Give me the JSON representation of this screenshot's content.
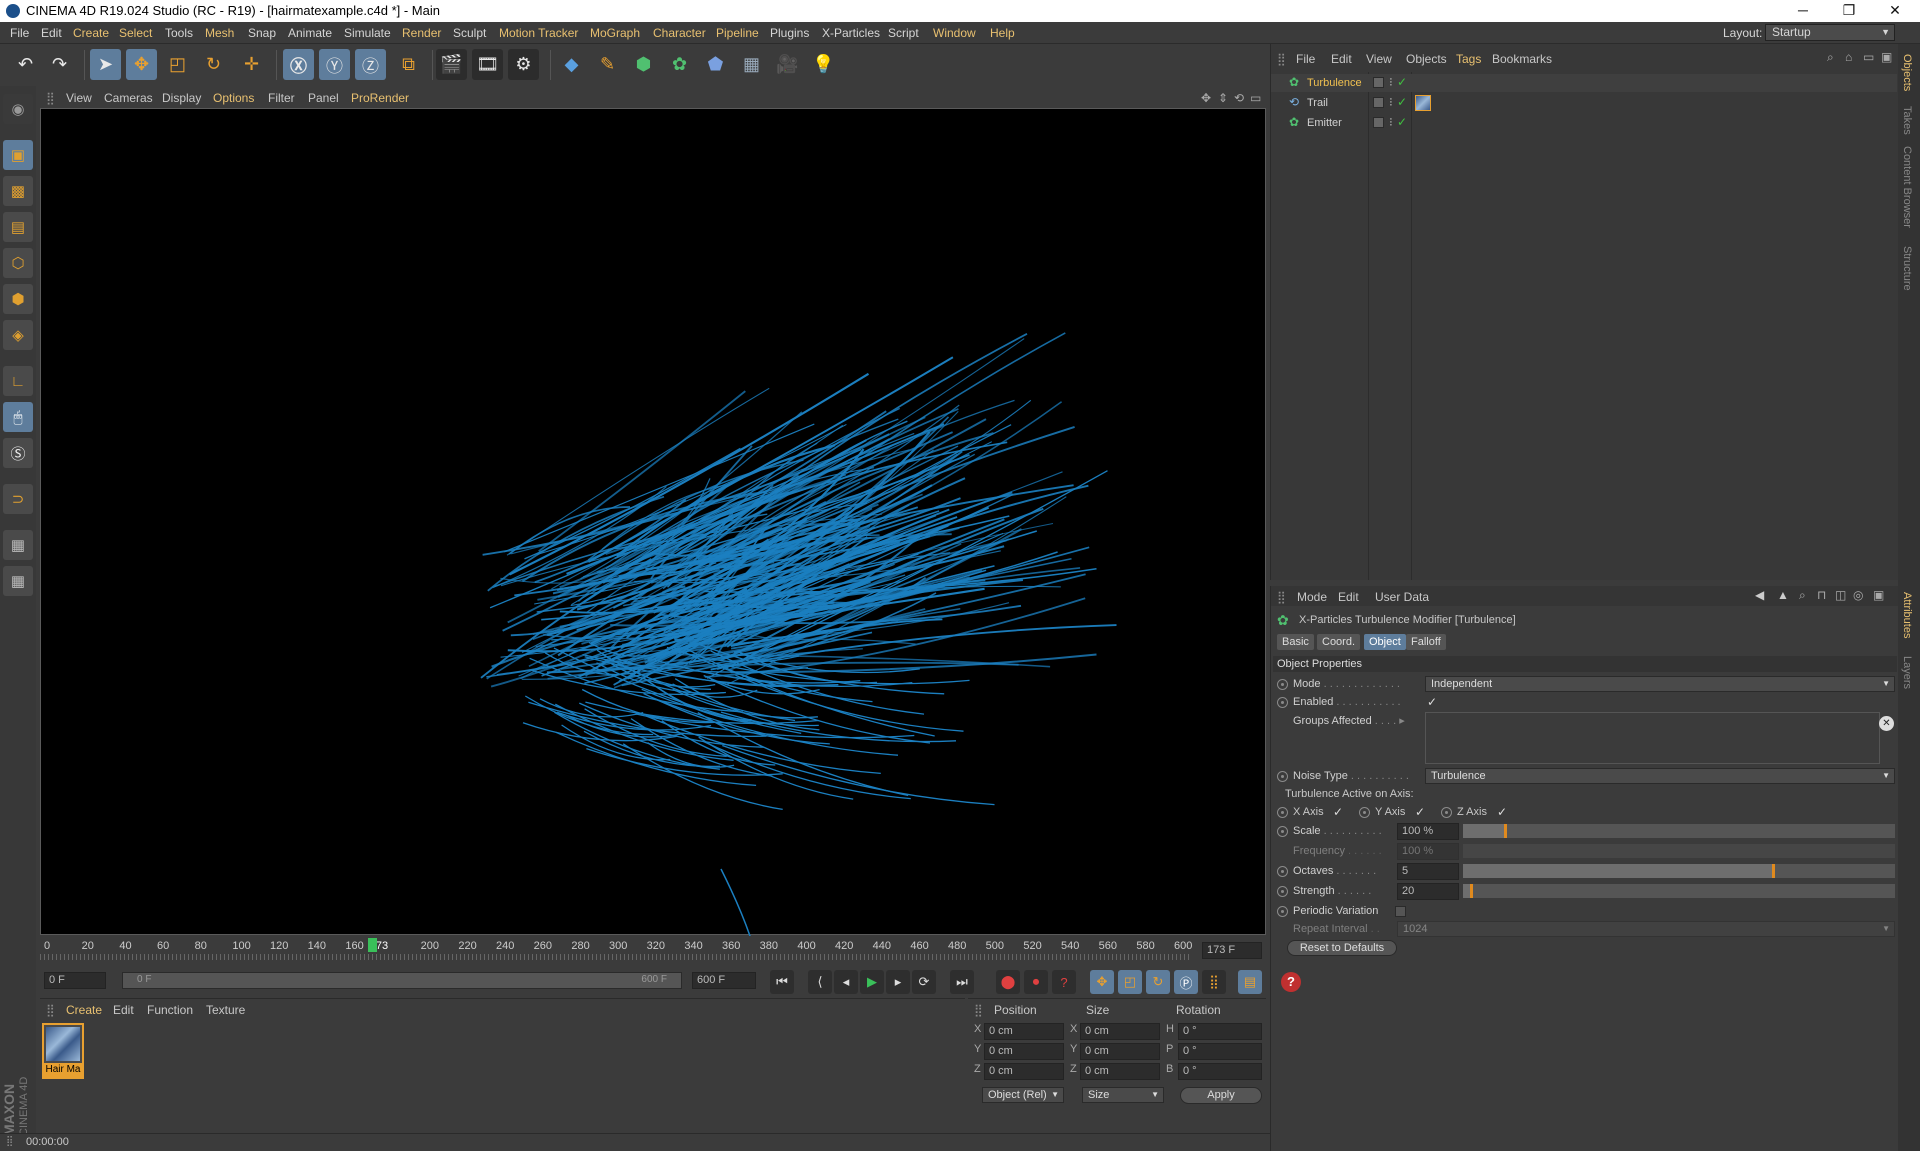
{
  "window": {
    "title": "CINEMA 4D R19.024 Studio (RC - R19) - [hairmatexample.c4d *] - Main",
    "minimize": "─",
    "maximize": "❐",
    "close": "✕"
  },
  "menu": [
    "File",
    "Edit",
    "Create",
    "Select",
    "Tools",
    "Mesh",
    "Snap",
    "Animate",
    "Simulate",
    "Render",
    "Sculpt",
    "Motion Tracker",
    "MoGraph",
    "Character",
    "Pipeline",
    "Plugins",
    "X-Particles",
    "Script",
    "Window",
    "Help"
  ],
  "layout": {
    "label": "Layout:",
    "value": "Startup"
  },
  "viewport_menu": [
    "View",
    "Cameras",
    "Display",
    "Options",
    "Filter",
    "Panel",
    "ProRender"
  ],
  "timeline": {
    "ticks": [
      "0",
      "20",
      "40",
      "60",
      "80",
      "100",
      "120",
      "140",
      "160",
      "173",
      "200",
      "220",
      "240",
      "260",
      "280",
      "300",
      "320",
      "340",
      "360",
      "380",
      "400",
      "420",
      "440",
      "460",
      "480",
      "500",
      "520",
      "540",
      "560",
      "580",
      "600"
    ],
    "current_frame": 173,
    "current_label": "173 F"
  },
  "transport": {
    "start": "0 F",
    "range_start": "0 F",
    "range_end": "600 F",
    "end": "600 F"
  },
  "material_panel": {
    "menu": [
      "Create",
      "Edit",
      "Function",
      "Texture"
    ],
    "material_name": "Hair Ma"
  },
  "coords": {
    "headers": [
      "Position",
      "Size",
      "Rotation"
    ],
    "rows": [
      {
        "a": "X",
        "pos": "0 cm",
        "b": "X",
        "size": "0 cm",
        "c": "H",
        "rot": "0 °"
      },
      {
        "a": "Y",
        "pos": "0 cm",
        "b": "Y",
        "size": "0 cm",
        "c": "P",
        "rot": "0 °"
      },
      {
        "a": "Z",
        "pos": "0 cm",
        "b": "Z",
        "size": "0 cm",
        "c": "B",
        "rot": "0 °"
      }
    ],
    "mode": "Object (Rel)",
    "size_mode": "Size",
    "apply": "Apply"
  },
  "status": {
    "time": "00:00:00"
  },
  "object_manager": {
    "menu": [
      "File",
      "Edit",
      "View",
      "Objects",
      "Tags",
      "Bookmarks"
    ],
    "objects": [
      {
        "name": "Turbulence",
        "selected": true
      },
      {
        "name": "Trail",
        "selected": false
      },
      {
        "name": "Emitter",
        "selected": false
      }
    ]
  },
  "attributes": {
    "menu": [
      "Mode",
      "Edit",
      "User Data"
    ],
    "title": "X-Particles Turbulence Modifier [Turbulence]",
    "tabs": [
      "Basic",
      "Coord.",
      "Object",
      "Falloff"
    ],
    "active_tab": "Object",
    "section": "Object Properties",
    "mode": {
      "label": "Mode",
      "value": "Independent"
    },
    "enabled": {
      "label": "Enabled",
      "value": "✓"
    },
    "groups": {
      "label": "Groups Affected"
    },
    "noise_type": {
      "label": "Noise Type",
      "value": "Turbulence"
    },
    "axis_label": "Turbulence Active on Axis:",
    "axes": [
      {
        "label": "X Axis",
        "check": "✓"
      },
      {
        "label": "Y Axis",
        "check": "✓"
      },
      {
        "label": "Z Axis",
        "check": "✓"
      }
    ],
    "scale": {
      "label": "Scale",
      "value": "100 %",
      "level": 0.1
    },
    "frequency": {
      "label": "Frequency",
      "value": "100 %"
    },
    "octaves": {
      "label": "Octaves",
      "value": "5",
      "level": 0.72
    },
    "strength": {
      "label": "Strength",
      "value": "20",
      "level": 0.02
    },
    "periodic": {
      "label": "Periodic Variation"
    },
    "repeat": {
      "label": "Repeat Interval",
      "value": "1024"
    },
    "reset": "Reset to Defaults"
  },
  "right_tabs": [
    "Objects",
    "Takes",
    "Content Browser",
    "Structure",
    "Attributes",
    "Layers"
  ],
  "brand": {
    "top": "MAXON",
    "bottom": "CINEMA 4D"
  },
  "colors": {
    "hair": "#1b7fc0",
    "accent": "#e0a030",
    "highlight": "#5e7d9c"
  }
}
